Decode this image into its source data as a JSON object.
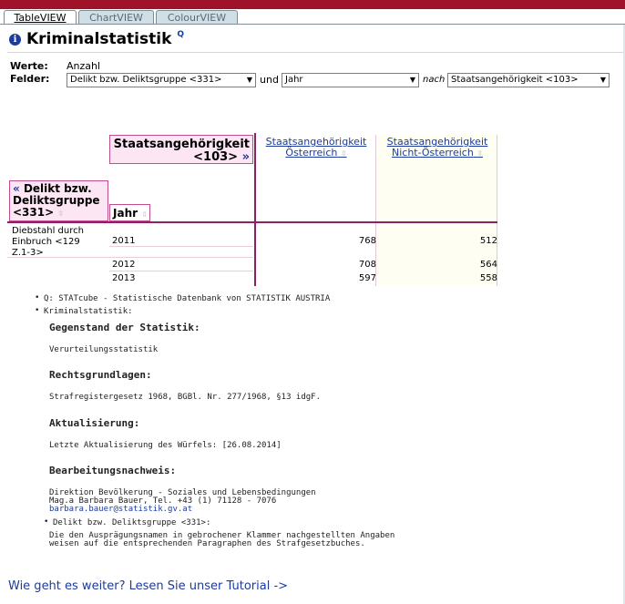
{
  "tabs": [
    {
      "label": "TableVIEW",
      "active": true
    },
    {
      "label": "ChartVIEW",
      "active": false
    },
    {
      "label": "ColourVIEW",
      "active": false
    }
  ],
  "header": {
    "title": "Kriminalstatistik",
    "qlink": "Q"
  },
  "werte": {
    "label": "Werte:",
    "value": "Anzahl"
  },
  "felder": {
    "label": "Felder:",
    "select1": "Delikt bzw. Deliktsgruppe <331>",
    "und": "und",
    "select2": "Jahr",
    "nach": "nach",
    "select3": "Staatsangehörigkeit <103>"
  },
  "table": {
    "state_dim": {
      "line1": "Staatsangehörigkeit",
      "line2": "<103>",
      "chev": "»"
    },
    "delikt_dim": {
      "chev": "«",
      "line1": "Delikt bzw.",
      "line2": "Deliktsgruppe",
      "line3": "<331>"
    },
    "jahr_dim": "Jahr",
    "col1": {
      "line1": "Staatsangehörigkeit",
      "line2": "Österreich"
    },
    "col2": {
      "line1": "Staatsangehörigkeit",
      "line2": "Nicht-Österreich"
    },
    "row_label": {
      "line1": "Diebstahl durch",
      "line2": "Einbruch <129",
      "line3": "Z.1-3>"
    },
    "rows": [
      {
        "year": "2011",
        "v1": "768",
        "v2": "512"
      },
      {
        "year": "2012",
        "v1": "708",
        "v2": "564"
      },
      {
        "year": "2013",
        "v1": "597",
        "v2": "558"
      }
    ]
  },
  "notes": {
    "q_source": "Q: STATcube - Statistische Datenbank von STATISTIK AUSTRIA",
    "krim": "Kriminalstatistik:",
    "gegenstand_h": "Gegenstand der Statistik:",
    "gegenstand_t": "Verurteilungsstatistik",
    "recht_h": "Rechtsgrundlagen:",
    "recht_t": "Strafregistergesetz 1968, BGBl. Nr. 277/1968, §13 idgF.",
    "akt_h": "Aktualisierung:",
    "akt_t": "Letzte Aktualisierung des Würfels: [26.08.2014]",
    "bearb_h": "Bearbeitungsnachweis:",
    "bearb_1": "Direktion Bevölkerung - Soziales und Lebensbedingungen",
    "bearb_2": "Mag.a Barbara Bauer, Tel. +43 (1) 71128 - 7076",
    "bearb_3": "barbara.bauer@statistik.gv.at",
    "delikt": "Delikt bzw. Deliktsgruppe <331>:",
    "delikt_1": "Die den Ausprägungsnamen in gebrochener Klammer nachgestellten Angaben",
    "delikt_2": "weisen auf die entsprechenden Paragraphen des Strafgesetzbuches."
  },
  "tutorial": "Wie geht es weiter? Lesen Sie unser Tutorial ->"
}
